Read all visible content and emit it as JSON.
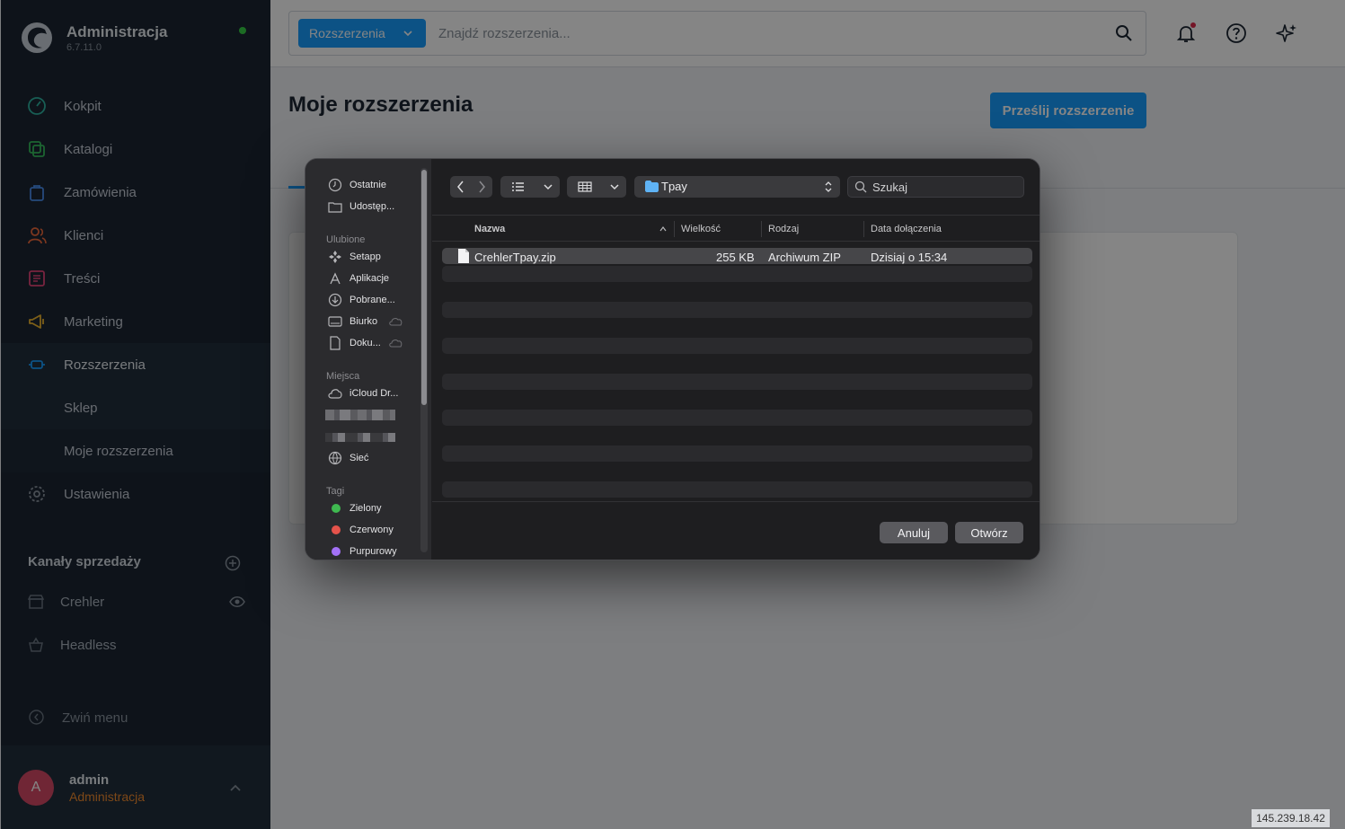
{
  "app": {
    "title": "Administracja",
    "version": "6.7.11.0"
  },
  "sidebar": {
    "items": [
      {
        "label": "Kokpit",
        "icon": "dashboard-icon"
      },
      {
        "label": "Katalogi",
        "icon": "catalog-icon"
      },
      {
        "label": "Zamówienia",
        "icon": "orders-bag-icon"
      },
      {
        "label": "Klienci",
        "icon": "customers-icon"
      },
      {
        "label": "Treści",
        "icon": "content-icon"
      },
      {
        "label": "Marketing",
        "icon": "megaphone-icon"
      },
      {
        "label": "Rozszerzenia",
        "icon": "plug-icon"
      },
      {
        "label": "Sklep",
        "icon": ""
      },
      {
        "label": "Moje rozszerzenia",
        "icon": ""
      },
      {
        "label": "Ustawienia",
        "icon": "gear-icon"
      }
    ],
    "channels_title": "Kanały sprzedaży",
    "channels": [
      {
        "label": "Crehler",
        "icon": "storefront-icon"
      },
      {
        "label": "Headless",
        "icon": "basket-icon"
      }
    ],
    "collapse_label": "Zwiń menu",
    "user": {
      "initial": "A",
      "name": "admin",
      "role": "Administracja"
    }
  },
  "topbar": {
    "search_type": "Rozszerzenia",
    "search_placeholder": "Znajdź rozszerzenia..."
  },
  "main": {
    "title": "Moje rozszerzenia",
    "upload_label": "Prześlij rozszerzenie"
  },
  "dialog": {
    "sidebar": {
      "top_items": [
        "Ostatnie",
        "Udostęp..."
      ],
      "favorites_title": "Ulubione",
      "favorites": [
        "Setapp",
        "Aplikacje",
        "Pobrane...",
        "Biurko",
        "Doku..."
      ],
      "places_title": "Miejsca",
      "places": [
        "iCloud Dr...",
        "Sieć"
      ],
      "tags_title": "Tagi",
      "tags": [
        {
          "label": "Zielony",
          "color": "#3fb950"
        },
        {
          "label": "Czerwony",
          "color": "#e5534b"
        },
        {
          "label": "Purpurowy",
          "color": "#a371f7"
        }
      ]
    },
    "path": "Tpay",
    "search_placeholder": "Szukaj",
    "columns": [
      "Nazwa",
      "Wielkość",
      "Rodzaj",
      "Data dołączenia"
    ],
    "files": [
      {
        "name": "CrehlerTpay.zip",
        "size": "255 KB",
        "kind": "Archiwum ZIP",
        "date": "Dzisiaj o 15:34"
      }
    ],
    "cancel_label": "Anuluj",
    "open_label": "Otwórz"
  },
  "ip_label": "145.239.18.42",
  "colors": {
    "accent": "#189eff",
    "sidebar_bg": "#1b2632",
    "user_role": "#f08a2e",
    "status_online": "#37d046"
  }
}
